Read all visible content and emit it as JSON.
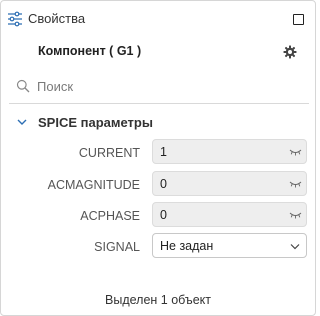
{
  "panel": {
    "title": "Свойства",
    "title_icon": "sliders-icon",
    "maximize_icon": "maximize-icon"
  },
  "component": {
    "title": "Компонент ( G1 )",
    "settings_icon": "gear-icon"
  },
  "search": {
    "placeholder": "Поиск",
    "value": ""
  },
  "section": {
    "title": "SPICE параметры",
    "expanded": true
  },
  "params": [
    {
      "label": "CURRENT",
      "value": "1",
      "icon": "eye-closed-icon"
    },
    {
      "label": "ACMAGNITUDE",
      "value": "0",
      "icon": "eye-closed-icon"
    },
    {
      "label": "ACPHASE",
      "value": "0",
      "icon": "eye-closed-icon"
    },
    {
      "label": "SIGNAL",
      "value": "Не задан",
      "icon": "chevron-down-icon"
    }
  ],
  "footer": {
    "status": "Выделен 1 объект"
  },
  "colors": {
    "accent": "#2d6fb4",
    "field_bg": "#eeeeee",
    "border": "#d6d6d6"
  }
}
